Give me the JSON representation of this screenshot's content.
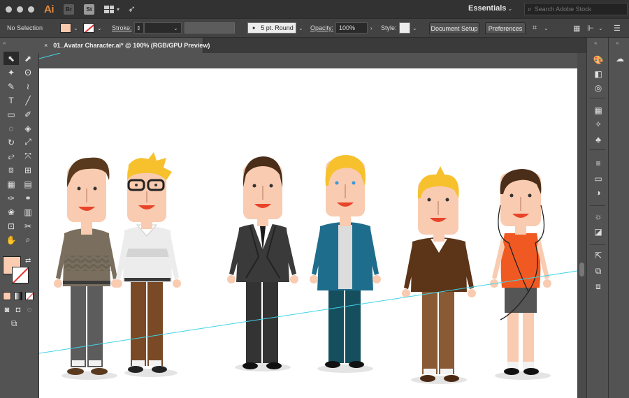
{
  "app": {
    "logo": "Ai",
    "bridge_icon": "Br",
    "stock_icon": "St",
    "workspace": "Essentials",
    "search_placeholder": "Search Adobe Stock"
  },
  "control_bar": {
    "selection": "No Selection",
    "stroke_label": "Stroke:",
    "brush": "5 pt. Round",
    "opacity_label": "Opacity:",
    "opacity_value": "100%",
    "style_label": "Style:",
    "document_setup": "Document Setup",
    "preferences": "Preferences"
  },
  "document": {
    "tab_close": "×",
    "tab_title": "01_Avatar Character.ai* @ 100% (RGB/GPU Preview)"
  },
  "colors": {
    "fill": "#f8c9ac",
    "skin": "#f9cbb0",
    "guide": "#3fd4e8"
  },
  "icons": {
    "tools": [
      "selection-tool",
      "direct-selection-tool",
      "magic-wand-tool",
      "lasso-tool",
      "pen-tool",
      "curvature-tool",
      "type-tool",
      "line-tool",
      "rectangle-tool",
      "paintbrush-tool",
      "shaper-tool",
      "eraser-tool",
      "rotate-tool",
      "scale-tool",
      "width-tool",
      "free-transform-tool",
      "shape-builder-tool",
      "perspective-grid-tool",
      "mesh-tool",
      "gradient-tool",
      "eyedropper-tool",
      "blend-tool",
      "symbol-sprayer-tool",
      "column-graph-tool",
      "artboard-tool",
      "slice-tool",
      "hand-tool",
      "zoom-tool"
    ],
    "right_panel": [
      "color-icon",
      "color-guide-icon",
      "cc-libraries-icon",
      "swatches-icon",
      "brushes-icon",
      "symbols-icon",
      "stroke-icon",
      "gradient-icon",
      "transparency-icon",
      "appearance-icon",
      "graphic-styles-icon",
      "export-icon",
      "layers-icon",
      "artboards-icon"
    ]
  }
}
